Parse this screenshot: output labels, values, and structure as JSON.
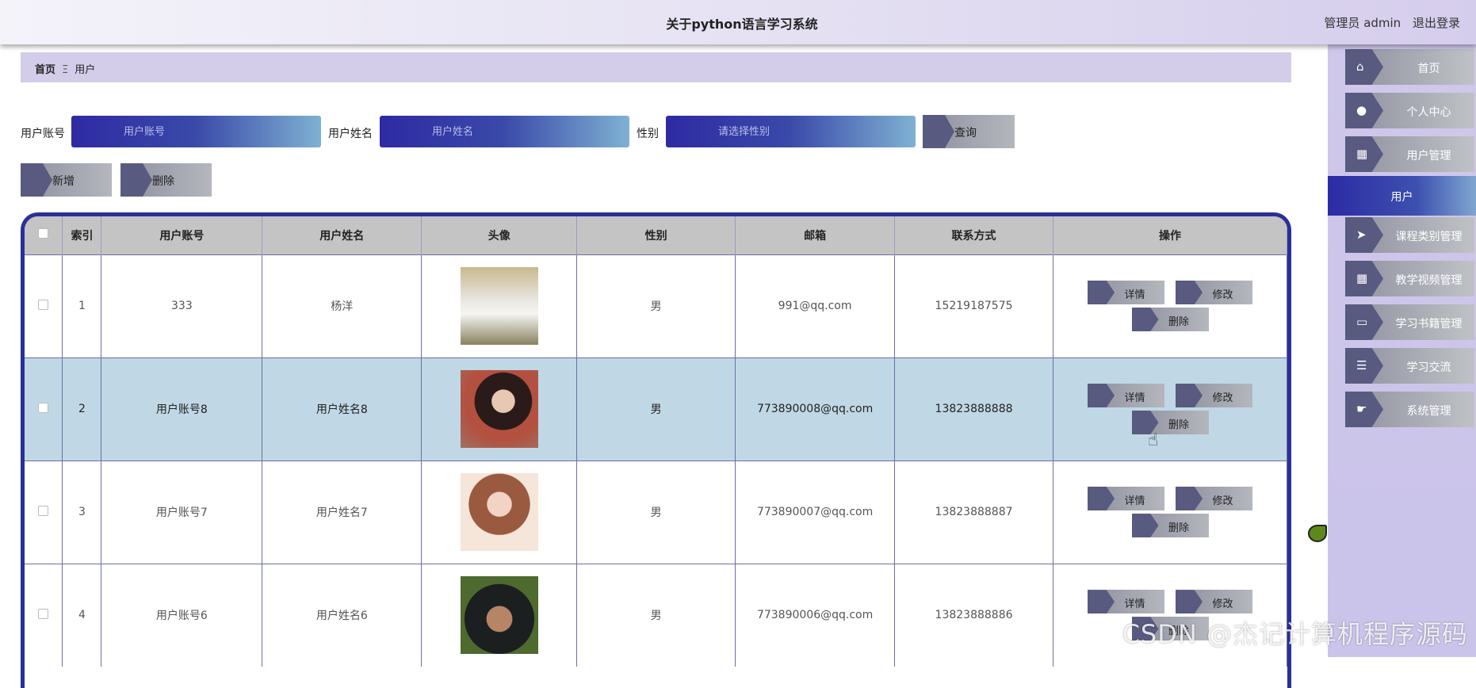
{
  "header": {
    "title": "关于python语言学习系统",
    "user_label": "管理员 admin",
    "logout_label": "退出登录"
  },
  "breadcrumb": {
    "home": "首页",
    "separator": "Ξ",
    "current": "用户"
  },
  "search": {
    "account_label": "用户账号",
    "account_placeholder": "用户账号",
    "name_label": "用户姓名",
    "name_placeholder": "用户姓名",
    "gender_label": "性别",
    "gender_placeholder": "请选择性别",
    "query_label": "查询"
  },
  "actions": {
    "add_label": "新增",
    "delete_label": "删除"
  },
  "table": {
    "headers": [
      "",
      "索引",
      "用户账号",
      "用户姓名",
      "头像",
      "性别",
      "邮箱",
      "联系方式",
      "操作"
    ],
    "op_labels": {
      "detail": "详情",
      "edit": "修改",
      "delete": "删除"
    },
    "rows": [
      {
        "index": "1",
        "account": "333",
        "name": "杨洋",
        "gender": "男",
        "email": "991@qq.com",
        "phone": "15219187575"
      },
      {
        "index": "2",
        "account": "用户账号8",
        "name": "用户姓名8",
        "gender": "男",
        "email": "773890008@qq.com",
        "phone": "13823888888"
      },
      {
        "index": "3",
        "account": "用户账号7",
        "name": "用户姓名7",
        "gender": "男",
        "email": "773890007@qq.com",
        "phone": "13823888887"
      },
      {
        "index": "4",
        "account": "用户账号6",
        "name": "用户姓名6",
        "gender": "男",
        "email": "773890006@qq.com",
        "phone": "13823888886"
      }
    ]
  },
  "sidebar": {
    "items": [
      {
        "label": "首页",
        "icon": "home-icon"
      },
      {
        "label": "个人中心",
        "icon": "person-icon"
      },
      {
        "label": "用户管理",
        "icon": "grid-icon"
      },
      {
        "label": "课程类别管理",
        "icon": "send-icon"
      },
      {
        "label": "教学视频管理",
        "icon": "grid-icon"
      },
      {
        "label": "学习书籍管理",
        "icon": "monitor-icon"
      },
      {
        "label": "学习交流",
        "icon": "list-icon"
      },
      {
        "label": "系统管理",
        "icon": "hand-icon"
      }
    ],
    "active_label": "用户"
  },
  "watermark": "CSDN @杰记计算机程序源码"
}
